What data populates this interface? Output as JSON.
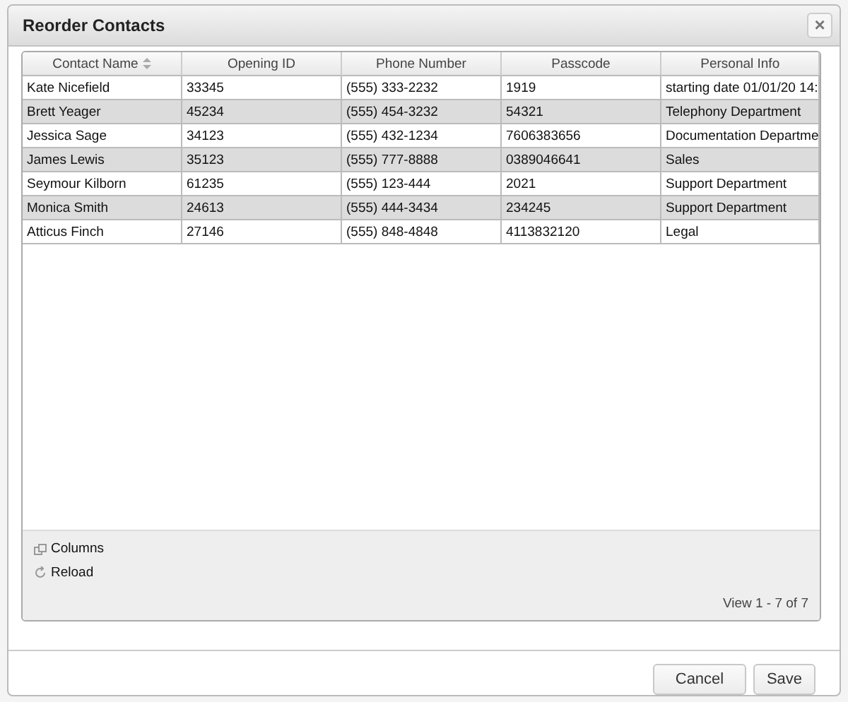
{
  "dialog": {
    "title": "Reorder Contacts",
    "close": "×"
  },
  "table": {
    "columns": [
      {
        "label": "Contact Name",
        "sorted": true
      },
      {
        "label": "Opening ID",
        "sorted": false
      },
      {
        "label": "Phone Number",
        "sorted": false
      },
      {
        "label": "Passcode",
        "sorted": false
      },
      {
        "label": "Personal Info",
        "sorted": false
      }
    ],
    "rows": [
      [
        "Kate Nicefield",
        "33345",
        "(555) 333-2232",
        "1919",
        "starting date 01/01/20 14:"
      ],
      [
        "Brett Yeager",
        "45234",
        "(555) 454-3232",
        "54321",
        "Telephony Department"
      ],
      [
        "Jessica Sage",
        "34123",
        "(555) 432-1234",
        "7606383656",
        "Documentation Departme"
      ],
      [
        "James Lewis",
        "35123",
        "(555) 777-8888",
        "0389046641",
        "Sales"
      ],
      [
        "Seymour Kilborn",
        "61235",
        "(555) 123-444",
        "2021",
        "Support Department"
      ],
      [
        "Monica Smith",
        "24613",
        "(555) 444-3434",
        "234245",
        "Support Department"
      ],
      [
        "Atticus Finch",
        "27146",
        "(555) 848-4848",
        "4113832120",
        "Legal"
      ]
    ]
  },
  "toolbar": [
    {
      "kind": "columns",
      "label": "Columns"
    },
    {
      "kind": "reload",
      "label": "Reload"
    }
  ],
  "pager": "View 1 - 7 of 7",
  "buttons": [
    "Cancel",
    "Save"
  ]
}
